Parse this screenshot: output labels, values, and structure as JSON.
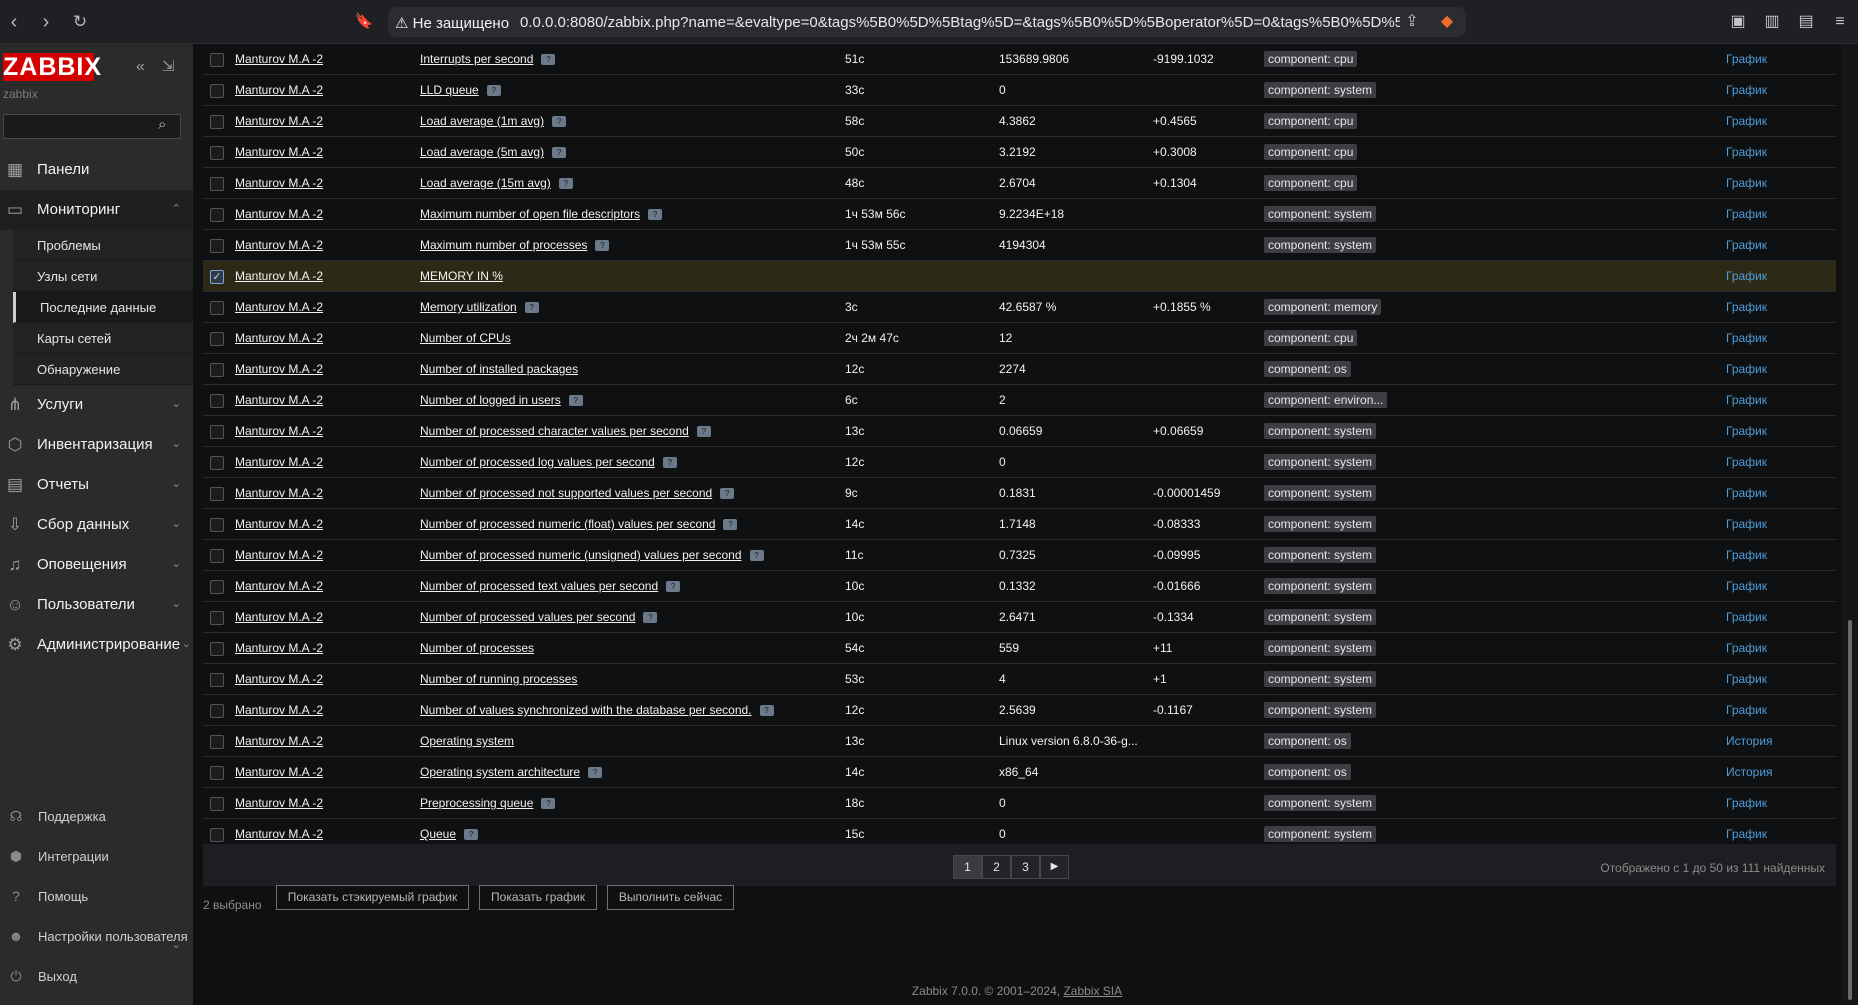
{
  "browser": {
    "warning": "⚠ Не защищено",
    "url": "0.0.0.0:8080/zabbix.php?name=&evaltype=0&tags%5B0%5D%5Btag%5D=&tags%5B0%5D%5Boperator%5D=0&tags%5B0%5D%5Bvalue..."
  },
  "sidebar": {
    "logo": "ZABBIX",
    "server_name": "zabbix",
    "search_placeholder": "",
    "menu": [
      {
        "label": "Панели",
        "icon": "dashboard-icon"
      },
      {
        "label": "Мониторинг",
        "icon": "monitoring-icon",
        "expanded": true
      },
      {
        "label": "Услуги",
        "icon": "services-icon"
      },
      {
        "label": "Инвентаризация",
        "icon": "inventory-icon"
      },
      {
        "label": "Отчеты",
        "icon": "reports-icon"
      },
      {
        "label": "Сбор данных",
        "icon": "data-collection-icon"
      },
      {
        "label": "Оповещения",
        "icon": "alerts-icon"
      },
      {
        "label": "Пользователи",
        "icon": "users-icon"
      },
      {
        "label": "Администрирование",
        "icon": "administration-icon"
      }
    ],
    "submenu": [
      {
        "label": "Проблемы"
      },
      {
        "label": "Узлы сети"
      },
      {
        "label": "Последние данные",
        "current": true
      },
      {
        "label": "Карты сетей"
      },
      {
        "label": "Обнаружение"
      }
    ],
    "footer": [
      {
        "label": "Поддержка",
        "icon": "support-icon"
      },
      {
        "label": "Интеграции",
        "icon": "integrations-icon"
      },
      {
        "label": "Помощь",
        "icon": "help-icon"
      },
      {
        "label": "Настройки пользователя",
        "icon": "user-settings-icon"
      },
      {
        "label": "Выход",
        "icon": "logout-icon"
      }
    ]
  },
  "rows": [
    {
      "host": "Manturov M.A -2",
      "name": "Interrupts per second",
      "help": true,
      "time": "51с",
      "value": "153689.9806",
      "change": "-9199.1032",
      "tag": "component: cpu",
      "link": "График"
    },
    {
      "host": "Manturov M.A -2",
      "name": "LLD queue",
      "help": true,
      "time": "33с",
      "value": "0",
      "change": "",
      "tag": "component: system",
      "link": "График"
    },
    {
      "host": "Manturov M.A -2",
      "name": "Load average (1m avg)",
      "help": true,
      "time": "58с",
      "value": "4.3862",
      "change": "+0.4565",
      "tag": "component: cpu",
      "link": "График"
    },
    {
      "host": "Manturov M.A -2",
      "name": "Load average (5m avg)",
      "help": true,
      "time": "50с",
      "value": "3.2192",
      "change": "+0.3008",
      "tag": "component: cpu",
      "link": "График"
    },
    {
      "host": "Manturov M.A -2",
      "name": "Load average (15m avg)",
      "help": true,
      "time": "48с",
      "value": "2.6704",
      "change": "+0.1304",
      "tag": "component: cpu",
      "link": "График"
    },
    {
      "host": "Manturov M.A -2",
      "name": "Maximum number of open file descriptors",
      "help": true,
      "time": "1ч 53м 56с",
      "value": "9.2234E+18",
      "change": "",
      "tag": "component: system",
      "link": "График"
    },
    {
      "host": "Manturov M.A -2",
      "name": "Maximum number of processes",
      "help": true,
      "time": "1ч 53м 55с",
      "value": "4194304",
      "change": "",
      "tag": "component: system",
      "link": "График"
    },
    {
      "host": "Manturov M.A -2",
      "name": "MEMORY IN %",
      "help": false,
      "time": "",
      "value": "",
      "change": "",
      "tag": "",
      "link": "График",
      "checked": true
    },
    {
      "host": "Manturov M.A -2",
      "name": "Memory utilization",
      "help": true,
      "time": "3с",
      "value": "42.6587 %",
      "change": "+0.1855 %",
      "tag": "component: memory",
      "link": "График"
    },
    {
      "host": "Manturov M.A -2",
      "name": "Number of CPUs",
      "help": false,
      "time": "2ч 2м 47с",
      "value": "12",
      "change": "",
      "tag": "component: cpu",
      "link": "График"
    },
    {
      "host": "Manturov M.A -2",
      "name": "Number of installed packages",
      "help": false,
      "time": "12с",
      "value": "2274",
      "change": "",
      "tag": "component: os",
      "link": "График"
    },
    {
      "host": "Manturov M.A -2",
      "name": "Number of logged in users",
      "help": true,
      "time": "6с",
      "value": "2",
      "change": "",
      "tag": "component: environ...",
      "link": "График"
    },
    {
      "host": "Manturov M.A -2",
      "name": "Number of processed character values per second",
      "help": true,
      "time": "13с",
      "value": "0.06659",
      "change": "+0.06659",
      "tag": "component: system",
      "link": "График"
    },
    {
      "host": "Manturov M.A -2",
      "name": "Number of processed log values per second",
      "help": true,
      "time": "12с",
      "value": "0",
      "change": "",
      "tag": "component: system",
      "link": "График"
    },
    {
      "host": "Manturov M.A -2",
      "name": "Number of processed not supported values per second",
      "help": true,
      "time": "9с",
      "value": "0.1831",
      "change": "-0.00001459",
      "tag": "component: system",
      "link": "График"
    },
    {
      "host": "Manturov M.A -2",
      "name": "Number of processed numeric (float) values per second",
      "help": true,
      "time": "14с",
      "value": "1.7148",
      "change": "-0.08333",
      "tag": "component: system",
      "link": "График"
    },
    {
      "host": "Manturov M.A -2",
      "name": "Number of processed numeric (unsigned) values per second",
      "help": true,
      "time": "11с",
      "value": "0.7325",
      "change": "-0.09995",
      "tag": "component: system",
      "link": "График"
    },
    {
      "host": "Manturov M.A -2",
      "name": "Number of processed text values per second",
      "help": true,
      "time": "10с",
      "value": "0.1332",
      "change": "-0.01666",
      "tag": "component: system",
      "link": "График"
    },
    {
      "host": "Manturov M.A -2",
      "name": "Number of processed values per second",
      "help": true,
      "time": "10с",
      "value": "2.6471",
      "change": "-0.1334",
      "tag": "component: system",
      "link": "График"
    },
    {
      "host": "Manturov M.A -2",
      "name": "Number of processes",
      "help": false,
      "time": "54с",
      "value": "559",
      "change": "+11",
      "tag": "component: system",
      "link": "График"
    },
    {
      "host": "Manturov M.A -2",
      "name": "Number of running processes",
      "help": false,
      "time": "53с",
      "value": "4",
      "change": "+1",
      "tag": "component: system",
      "link": "График"
    },
    {
      "host": "Manturov M.A -2",
      "name": "Number of values synchronized with the database per second.",
      "help": true,
      "time": "12с",
      "value": "2.5639",
      "change": "-0.1167",
      "tag": "component: system",
      "link": "График"
    },
    {
      "host": "Manturov M.A -2",
      "name": "Operating system",
      "help": false,
      "time": "13с",
      "value": "Linux version 6.8.0-36-g...",
      "change": "",
      "tag": "component: os",
      "link": "История"
    },
    {
      "host": "Manturov M.A -2",
      "name": "Operating system architecture",
      "help": true,
      "time": "14с",
      "value": "x86_64",
      "change": "",
      "tag": "component: os",
      "link": "История"
    },
    {
      "host": "Manturov M.A -2",
      "name": "Preprocessing queue",
      "help": true,
      "time": "18с",
      "value": "0",
      "change": "",
      "tag": "component: system",
      "link": "График"
    },
    {
      "host": "Manturov M.A -2",
      "name": "Queue",
      "help": true,
      "time": "15с",
      "value": "0",
      "change": "",
      "tag": "component: system",
      "link": "График"
    }
  ],
  "paging": {
    "pages": [
      "1",
      "2",
      "3"
    ],
    "current": "1",
    "next": "▶",
    "info": "Отображено с 1 до 50 из 111 найденных"
  },
  "actions": {
    "selected": "2 выбрано",
    "stacked_graph": "Показать стэкируемый график",
    "graph": "Показать график",
    "execute_now": "Выполнить сейчас"
  },
  "footer": {
    "text": "Zabbix 7.0.0. © 2001–2024, ",
    "link": "Zabbix SIA"
  }
}
